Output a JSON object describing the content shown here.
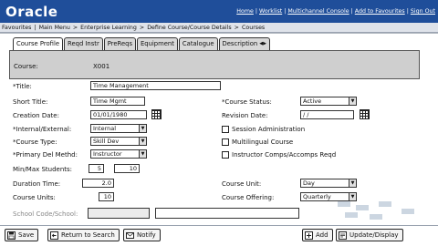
{
  "header": {
    "logo": "Oracle",
    "links": [
      "Home",
      "Worklist",
      "Multichannel Console",
      "Add to Favourites",
      "Sign Out"
    ]
  },
  "breadcrumbs": [
    "Favourites",
    "Main Menu",
    "Enterprise Learning",
    "Define Course/Course Details",
    "Courses"
  ],
  "tabs": [
    {
      "label": "Course Profile"
    },
    {
      "label": "Reqd Instr"
    },
    {
      "label": "PreReqs"
    },
    {
      "label": "Equipment"
    },
    {
      "label": "Catalogue"
    },
    {
      "label": "Description"
    }
  ],
  "course": {
    "label": "Course:",
    "value": "X001"
  },
  "form": {
    "title_label": "*Title:",
    "title_value": "Time Management",
    "short_title_label": "Short Title:",
    "short_title_value": "Time Mgmt",
    "creation_date_label": "Creation Date:",
    "creation_date_value": "01/01/1980",
    "internal_external_label": "*Internal/External:",
    "internal_external_value": "Internal",
    "course_type_label": "*Course Type:",
    "course_type_value": "Skill Dev",
    "primary_method_label": "*Primary Del Methd:",
    "primary_method_value": "Instructor",
    "min_max_label": "Min/Max Students:",
    "min_value": "5",
    "max_value": "10",
    "duration_label": "Duration Time:",
    "duration_value": "2.0",
    "course_units_label": "Course Units:",
    "course_units_value": "10",
    "school_label": "School Code/School:",
    "course_status_label": "*Course Status:",
    "course_status_value": "Active",
    "revision_date_label": "Revision Date:",
    "revision_date_value": "/  /",
    "session_admin_label": "Session Administration",
    "multilingual_label": "Multilingual Course",
    "instructor_comps_label": "Instructor Comps/Accomps Reqd",
    "course_unit_label": "Course Unit:",
    "course_unit_value": "Day",
    "course_offering_label": "Course Offering:",
    "course_offering_value": "Quarterly"
  },
  "footer": {
    "save": "Save",
    "return": "Return to Search",
    "notify": "Notify",
    "add": "Add",
    "update": "Update/Display"
  }
}
